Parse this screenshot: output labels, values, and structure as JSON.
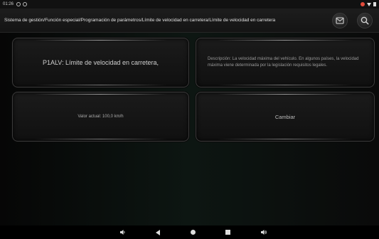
{
  "status_bar": {
    "time": "01:26"
  },
  "header": {
    "breadcrumb": "Sistema de gestión/Función especial/Programación de parámetros/Límite de velocidad en carretera/Límite de velocidad en carretera"
  },
  "tiles": {
    "parameter_title": "P1ALV: Límite de velocidad en carretera,",
    "description": "Descripción: La velocidad máxima del vehículo. En algunos países, la velocidad máxima viene determinada por la legislación requisitos legales.",
    "current_value": "Valor actual: 100,0 km/h",
    "change_label": "Cambiar"
  },
  "icons": {
    "message": "message-icon",
    "search": "search-icon",
    "volume_down": "volume-down-icon",
    "back": "back-icon",
    "home": "home-icon",
    "recents": "recents-icon",
    "volume_up": "volume-up-icon"
  }
}
